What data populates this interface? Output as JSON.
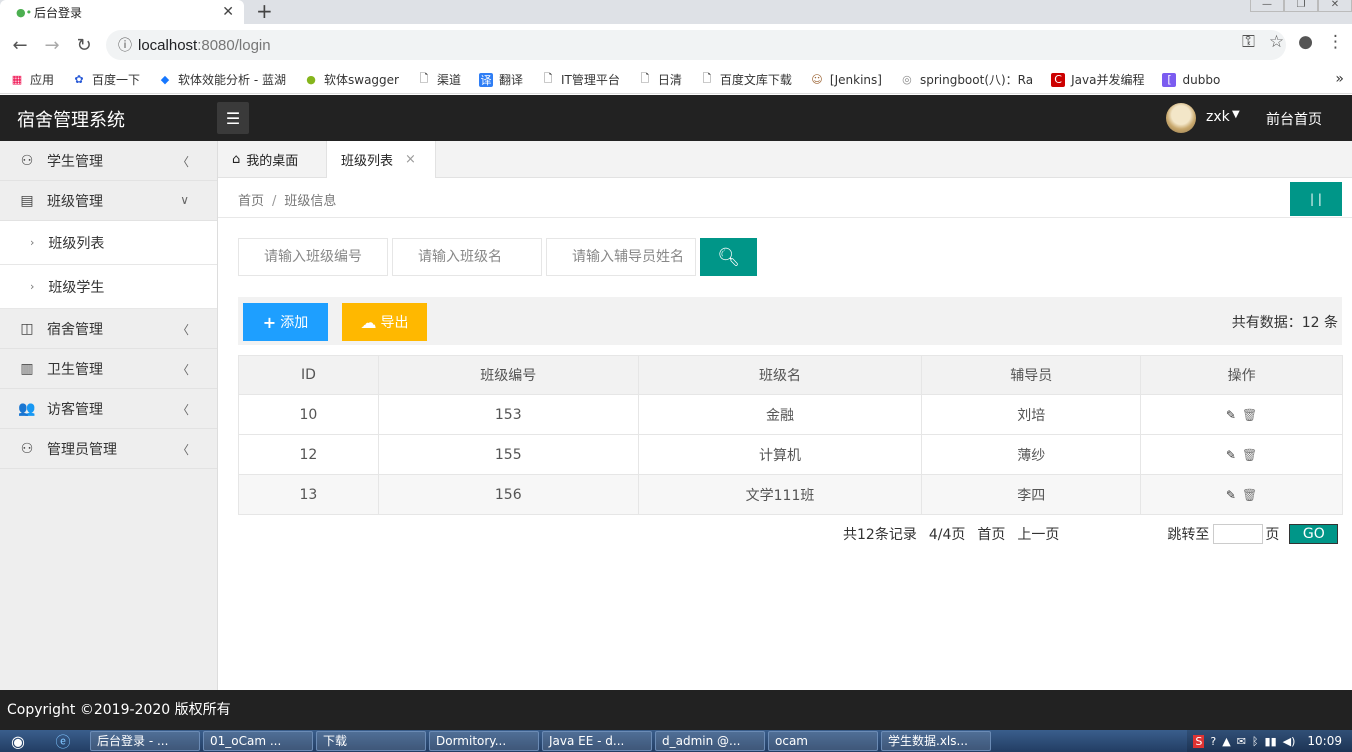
{
  "browser": {
    "tab_title": "后台登录",
    "new_tab": "+",
    "url_host": "localhost",
    "url_rest": ":8080/login",
    "bookmarks": [
      "应用",
      "百度一下",
      "软体效能分析 - 蓝湖",
      "软体swagger",
      "渠道",
      "翻译",
      "IT管理平台",
      "日清",
      "百度文库下载",
      "[Jenkins]",
      "springboot(八)：Ra",
      "Java并发编程",
      "dubbo"
    ]
  },
  "app": {
    "title": "宿舍管理系统",
    "user": "zxk",
    "front_link": "前台首页"
  },
  "sidebar": {
    "items": [
      {
        "label": "学生管理"
      },
      {
        "label": "班级管理"
      },
      {
        "label": "宿舍管理"
      },
      {
        "label": "卫生管理"
      },
      {
        "label": "访客管理"
      },
      {
        "label": "管理员管理"
      }
    ],
    "subitems": [
      {
        "label": "班级列表"
      },
      {
        "label": "班级学生"
      }
    ]
  },
  "tabs": {
    "home": "我的桌面",
    "current": "班级列表",
    "close": "×"
  },
  "breadcrumb": {
    "home": "首页",
    "sep": "/",
    "current": "班级信息"
  },
  "refresh_label": "| |",
  "search": {
    "class_no_placeholder": "请输入班级编号",
    "class_name_placeholder": "请输入班级名",
    "counselor_placeholder": "请输入辅导员姓名"
  },
  "toolbar": {
    "add": "添加",
    "export": "导出",
    "total": "共有数据：12 条"
  },
  "table": {
    "headers": [
      "ID",
      "班级编号",
      "班级名",
      "辅导员",
      "操作"
    ],
    "rows": [
      {
        "id": "10",
        "no": "153",
        "name": "金融",
        "counselor": "刘培"
      },
      {
        "id": "12",
        "no": "155",
        "name": "计算机",
        "counselor": "薄纱"
      },
      {
        "id": "13",
        "no": "156",
        "name": "文学111班",
        "counselor": "李四"
      }
    ]
  },
  "pager": {
    "records": "共12条记录",
    "pages": "4/4页",
    "first": "首页",
    "prev": "上一页",
    "jump": "跳转至",
    "page_unit": "页",
    "go": "GO"
  },
  "footer": "Copyright ©2019-2020 版权所有",
  "taskbar": {
    "tasks": [
      "后台登录 - ...",
      "01_oCam ...",
      "下载",
      "Dormitory...",
      "Java EE - d...",
      "d_admin @...",
      "ocam",
      "学生数据.xls..."
    ],
    "clock": "10:09"
  }
}
